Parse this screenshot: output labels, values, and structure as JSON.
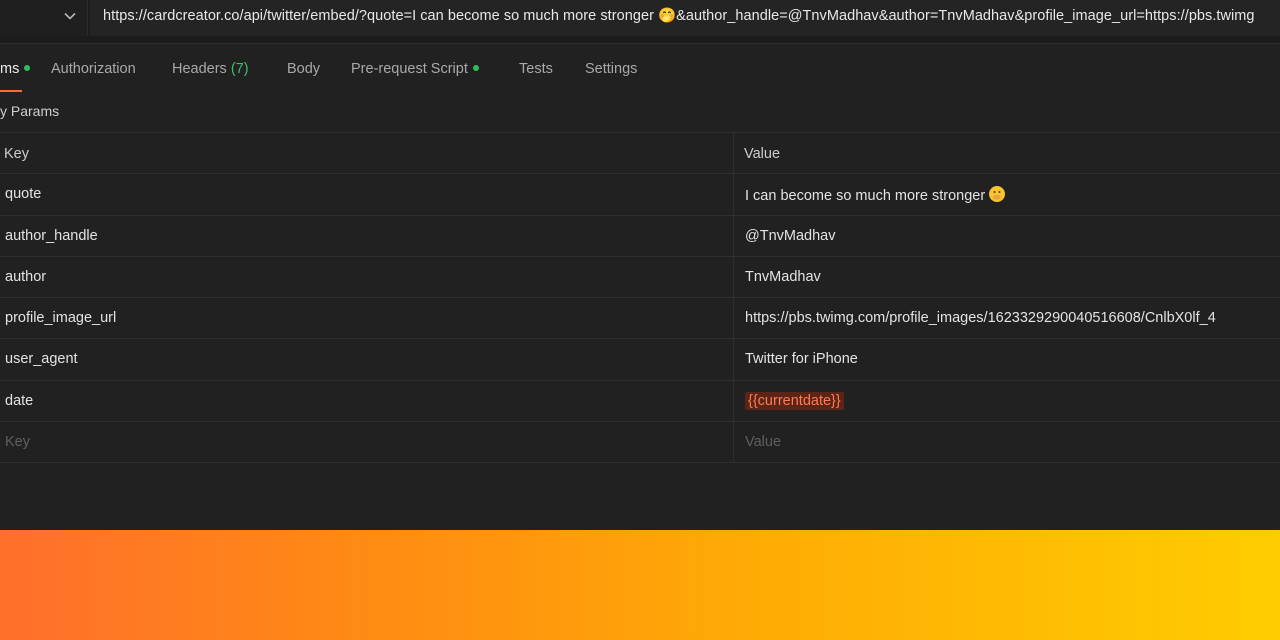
{
  "request": {
    "url": "https://cardcreator.co/api/twitter/embed/?quote=I can become so much more stronger 🤭&author_handle=@TnvMadhav&author=TnvMadhav&profile_image_url=https://pbs.twimg"
  },
  "tabs": [
    {
      "label": "ms",
      "active": true,
      "dot": true
    },
    {
      "label": "Authorization"
    },
    {
      "label": "Headers",
      "count": "(7)"
    },
    {
      "label": "Body"
    },
    {
      "label": "Pre-request Script",
      "dot": true
    },
    {
      "label": "Tests"
    },
    {
      "label": "Settings"
    }
  ],
  "section": {
    "label": "y Params"
  },
  "params": {
    "header": {
      "key": "Key",
      "value": "Value"
    },
    "rows": [
      {
        "key": "quote",
        "value": "I can become so much more stronger"
      },
      {
        "key": "author_handle",
        "value": "@TnvMadhav"
      },
      {
        "key": "author",
        "value": "TnvMadhav"
      },
      {
        "key": "profile_image_url",
        "value": "https://pbs.twimg.com/profile_images/1623329290040516608/CnlbX0lf_4"
      },
      {
        "key": "user_agent",
        "value": "Twitter for iPhone"
      },
      {
        "key": "date",
        "value": "{{currentdate}}"
      }
    ],
    "placeholder": {
      "key": "Key",
      "value": "Value"
    }
  },
  "colors": {
    "accent": "#ff6c37",
    "dot": "#2fbf5a",
    "variable_bg": "#5a2417",
    "variable_text": "#ff7b52",
    "gradient_start": "#ff6f2c",
    "gradient_end": "#ffcc00"
  },
  "icons": {
    "method_dropdown": "chevron-down-icon",
    "quote_emoji": "face-with-hand-over-mouth-icon"
  }
}
